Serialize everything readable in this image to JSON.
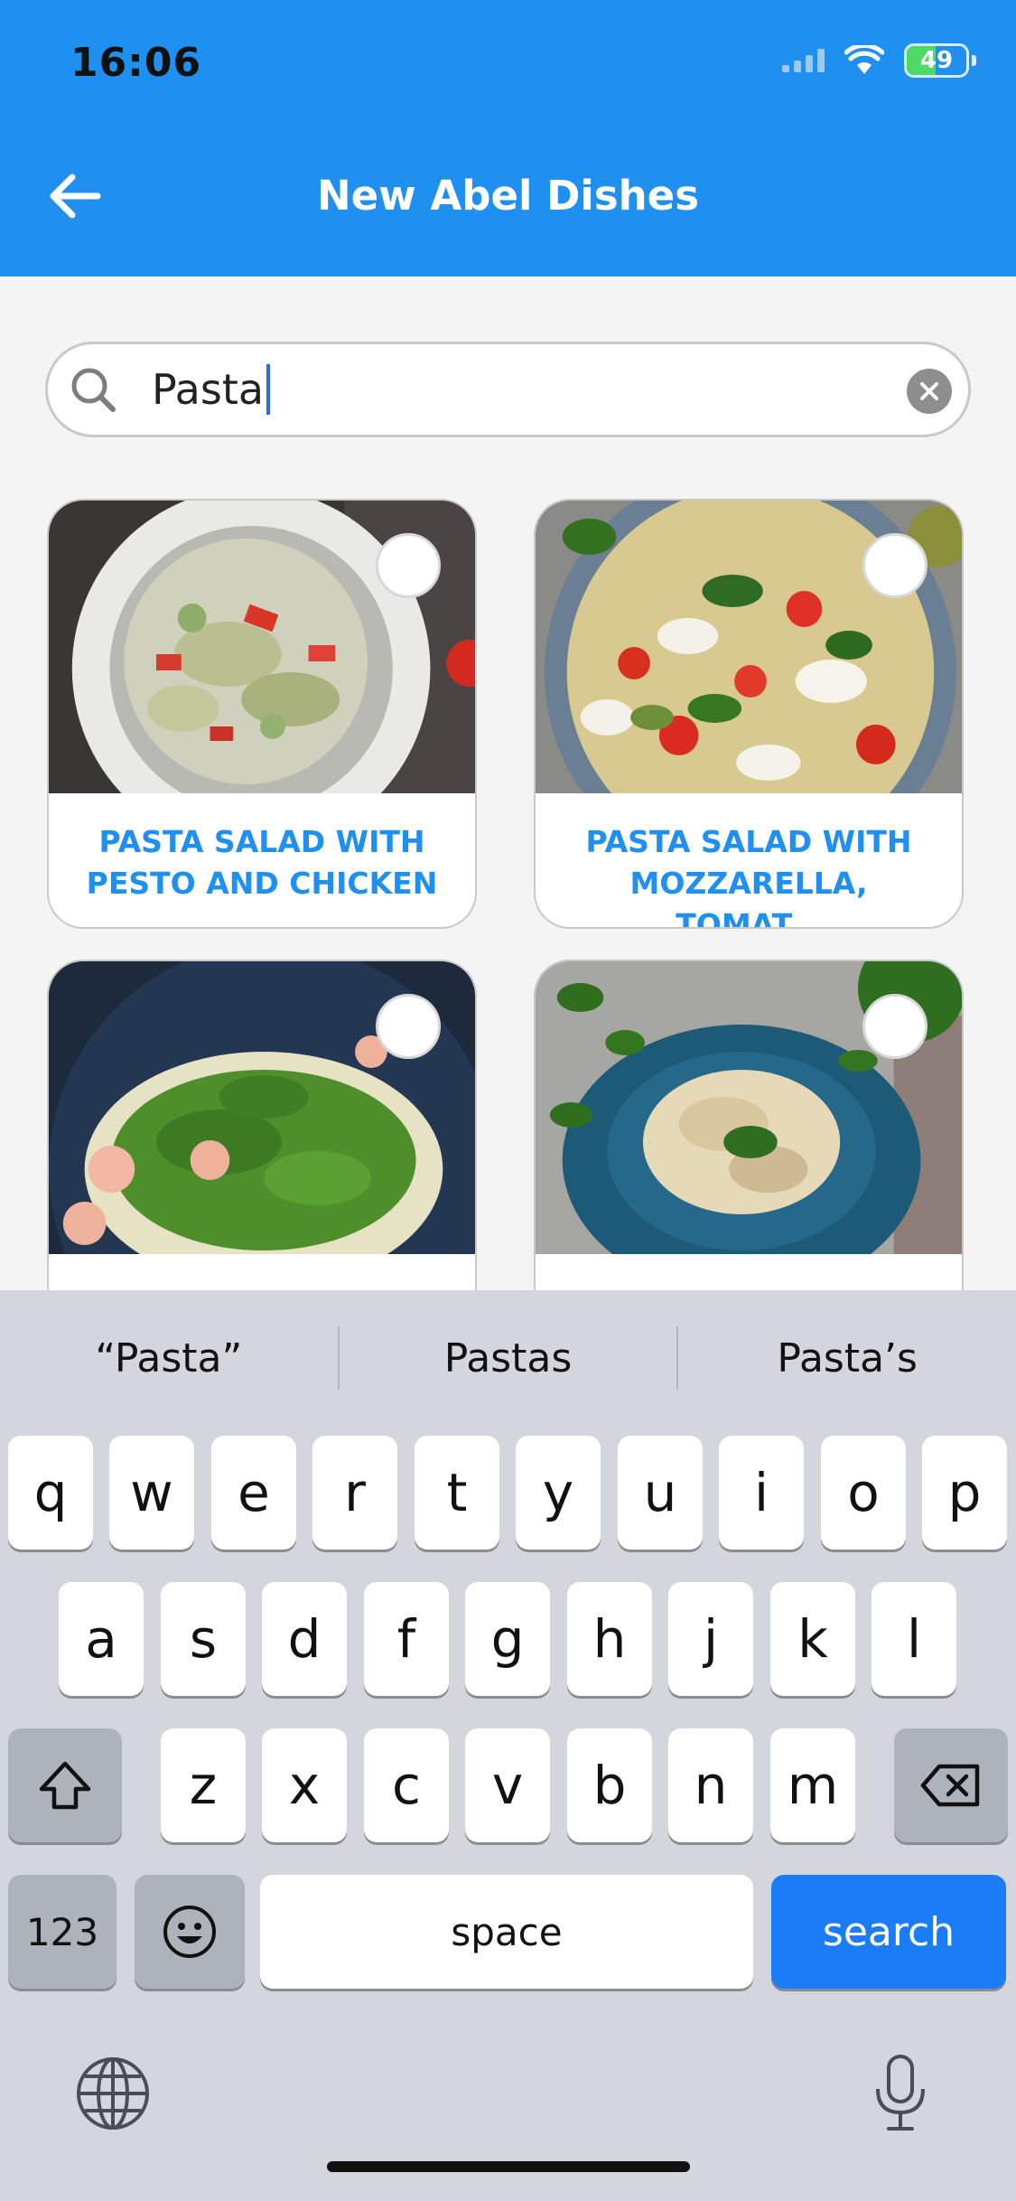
{
  "status_bar": {
    "time": "16:06",
    "battery": "49"
  },
  "header": {
    "title": "New Abel Dishes"
  },
  "search": {
    "value": "Pasta"
  },
  "dishes": [
    {
      "title": "PASTA SALAD WITH PESTO AND CHICKEN"
    },
    {
      "title": "PASTA SALAD WITH MOZZARELLA, TOMAT..."
    },
    {
      "title": ""
    },
    {
      "title": ""
    }
  ],
  "keyboard": {
    "suggestions": [
      "“Pasta”",
      "Pastas",
      "Pasta’s"
    ],
    "row1": [
      "q",
      "w",
      "e",
      "r",
      "t",
      "y",
      "u",
      "i",
      "o",
      "p"
    ],
    "row2": [
      "a",
      "s",
      "d",
      "f",
      "g",
      "h",
      "j",
      "k",
      "l"
    ],
    "row3": [
      "z",
      "x",
      "c",
      "v",
      "b",
      "n",
      "m"
    ],
    "numbers_label": "123",
    "space_label": "space",
    "action_label": "search"
  },
  "colors": {
    "accent": "#1f8ff0",
    "action_key": "#1a7cf7"
  }
}
